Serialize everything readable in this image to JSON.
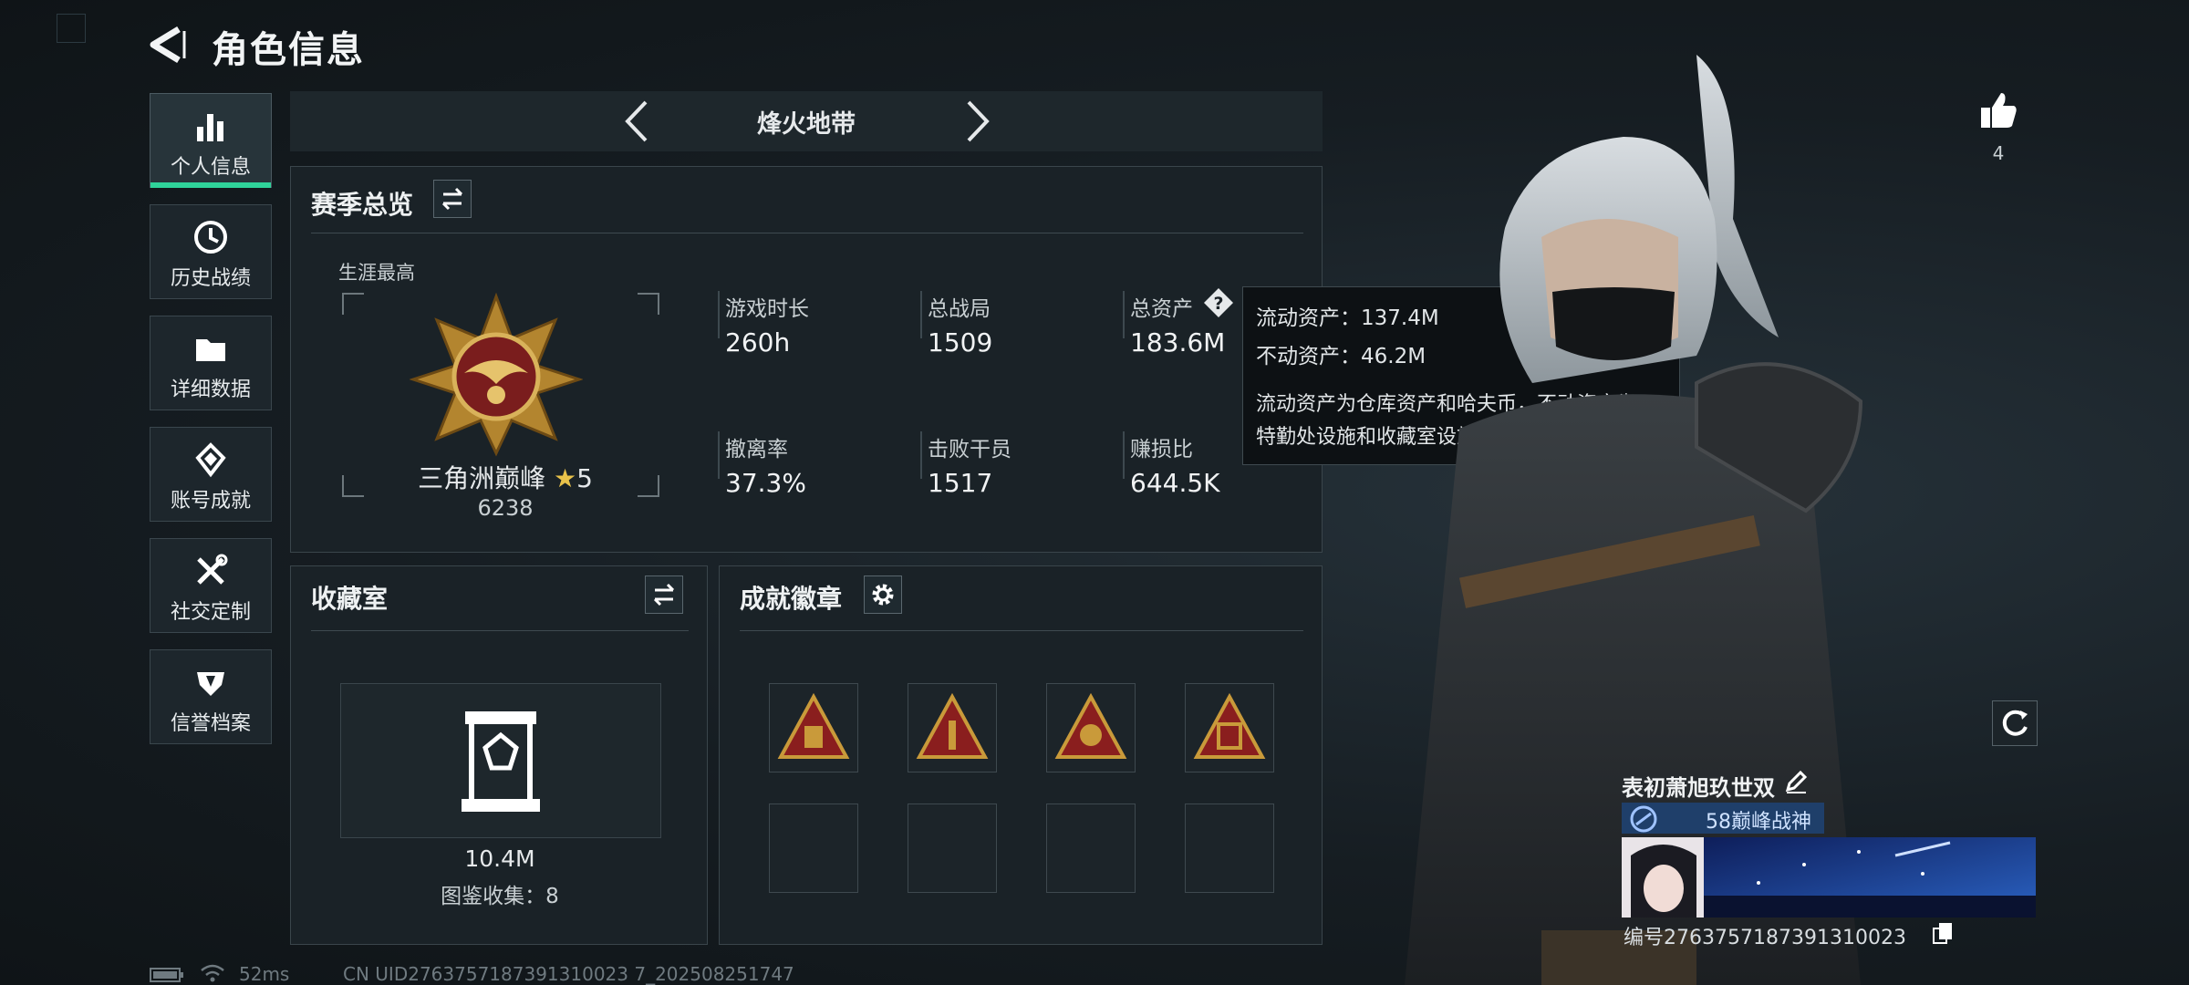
{
  "header": {
    "title": "角色信息"
  },
  "sidebar": {
    "items": [
      {
        "label": "个人信息",
        "icon": "bar-chart-icon",
        "active": true
      },
      {
        "label": "历史战绩",
        "icon": "clock-icon",
        "active": false
      },
      {
        "label": "详细数据",
        "icon": "folder-icon",
        "active": false
      },
      {
        "label": "账号成就",
        "icon": "achievement-icon",
        "active": false
      },
      {
        "label": "社交定制",
        "icon": "tools-icon",
        "active": false
      },
      {
        "label": "信誉档案",
        "icon": "shield-icon",
        "active": false
      }
    ]
  },
  "mode_selector": {
    "title": "烽火地带"
  },
  "season_overview": {
    "title": "赛季总览",
    "career_best_label": "生涯最高",
    "rank_name": "三角洲巅峰",
    "rank_stars": "5",
    "rank_score": "6238",
    "stats": [
      {
        "label": "游戏时长",
        "value": "260h"
      },
      {
        "label": "总战局",
        "value": "1509"
      },
      {
        "label": "总资产",
        "value": "183.6M"
      },
      {
        "label": "撤离率",
        "value": "37.3%"
      },
      {
        "label": "击败干员",
        "value": "1517"
      },
      {
        "label": "赚损比",
        "value": "644.5K"
      }
    ],
    "help_icon_text": "?"
  },
  "tooltip": {
    "liquid": "流动资产：137.4M",
    "fixed": "不动资产：46.2M",
    "desc_line1": "流动资产为仓库资产和哈夫币，不动资产为",
    "desc_line2": "特勤处设施和收藏室设施"
  },
  "collection": {
    "title": "收藏室",
    "value": "10.4M",
    "count_text": "图鉴收集：8"
  },
  "achievements": {
    "title": "成就徽章",
    "badges_filled": 4,
    "badges_total": 8
  },
  "likes": {
    "count": "4"
  },
  "profile": {
    "name": "表初萧旭玖世双",
    "rank_title": "58巅峰战神",
    "uid_line": "编号2763757187391310023"
  },
  "status_bar": {
    "ping": "52ms",
    "uid_text": "CN UID2763757187391310023 7_202508251747"
  },
  "colors": {
    "accent": "#2fd39a",
    "gold": "#c99a3a",
    "badge_red": "#8a1e1e",
    "rank_blue": "#1f3f6a"
  }
}
